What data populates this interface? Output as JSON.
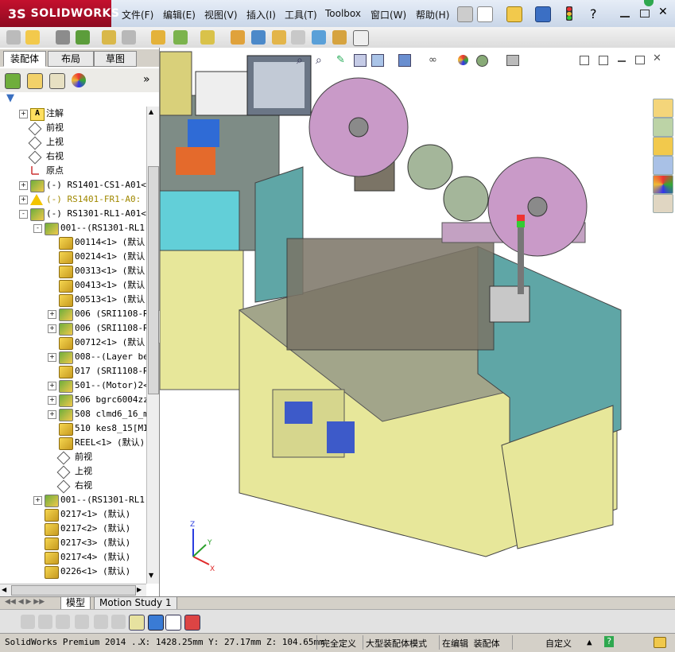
{
  "app": {
    "logo_ds": "3S",
    "logo_name": "SOLIDWORKS"
  },
  "menu": [
    "文件(F)",
    "编辑(E)",
    "视图(V)",
    "插入(I)",
    "工具(T)",
    "Toolbox",
    "窗口(W)",
    "帮助(H)"
  ],
  "panel_tabs": [
    "装配体",
    "布局",
    "草图"
  ],
  "tree": [
    {
      "label": "注解",
      "indent": 0,
      "icon": "note",
      "expand": "+"
    },
    {
      "label": "前视",
      "indent": 0,
      "icon": "plane",
      "expand": ""
    },
    {
      "label": "上视",
      "indent": 0,
      "icon": "plane",
      "expand": ""
    },
    {
      "label": "右视",
      "indent": 0,
      "icon": "plane",
      "expand": ""
    },
    {
      "label": "原点",
      "indent": 0,
      "icon": "origin",
      "expand": ""
    },
    {
      "label": "(-) RS1401-CS1-A01<1",
      "indent": 0,
      "icon": "asm",
      "expand": "+"
    },
    {
      "label": "(-) RS1401-FR1-A0:",
      "indent": 0,
      "icon": "warn",
      "expand": "+",
      "warn": true
    },
    {
      "label": "(-) RS1301-RL1-A01<1",
      "indent": 0,
      "icon": "asm",
      "expand": "-"
    },
    {
      "label": "001--(RS1301-RL1-",
      "indent": 1,
      "icon": "asm",
      "expand": "-"
    },
    {
      "label": "00114<1> (默认",
      "indent": 2,
      "icon": "part",
      "expand": ""
    },
    {
      "label": "00214<1> (默认",
      "indent": 2,
      "icon": "part",
      "expand": ""
    },
    {
      "label": "00313<1> (默认",
      "indent": 2,
      "icon": "part",
      "expand": ""
    },
    {
      "label": "00413<1> (默认",
      "indent": 2,
      "icon": "part",
      "expand": ""
    },
    {
      "label": "00513<1> (默认",
      "indent": 2,
      "icon": "part",
      "expand": ""
    },
    {
      "label": "006 (SRI1108-R",
      "indent": 2,
      "icon": "asm",
      "expand": "+"
    },
    {
      "label": "006 (SRI1108-R",
      "indent": 2,
      "icon": "asm",
      "expand": "+"
    },
    {
      "label": "00712<1> (默认",
      "indent": 2,
      "icon": "part",
      "expand": ""
    },
    {
      "label": "008--(Layer be",
      "indent": 2,
      "icon": "asm",
      "expand": "+"
    },
    {
      "label": "017 (SRI1108-R",
      "indent": 2,
      "icon": "part",
      "expand": ""
    },
    {
      "label": "501--(Motor)2<",
      "indent": 2,
      "icon": "asm",
      "expand": "+"
    },
    {
      "label": "506 bgrc6004zz",
      "indent": 2,
      "icon": "asm",
      "expand": "+"
    },
    {
      "label": "508 clmd6_16_m",
      "indent": 2,
      "icon": "asm",
      "expand": "+"
    },
    {
      "label": "510 kes8_15[MI",
      "indent": 2,
      "icon": "part",
      "expand": ""
    },
    {
      "label": "REEL<1> (默认)",
      "indent": 2,
      "icon": "part",
      "expand": ""
    },
    {
      "label": "前视",
      "indent": 2,
      "icon": "plane",
      "expand": ""
    },
    {
      "label": "上视",
      "indent": 2,
      "icon": "plane",
      "expand": ""
    },
    {
      "label": "右视",
      "indent": 2,
      "icon": "plane",
      "expand": ""
    },
    {
      "label": "001--(RS1301-RL1-",
      "indent": 1,
      "icon": "asm",
      "expand": "+"
    },
    {
      "label": "0217<1> (默认)",
      "indent": 1,
      "icon": "part",
      "expand": ""
    },
    {
      "label": "0217<2> (默认)",
      "indent": 1,
      "icon": "part",
      "expand": ""
    },
    {
      "label": "0217<3> (默认)",
      "indent": 1,
      "icon": "part",
      "expand": ""
    },
    {
      "label": "0217<4> (默认)",
      "indent": 1,
      "icon": "part",
      "expand": ""
    },
    {
      "label": "0226<1> (默认)",
      "indent": 1,
      "icon": "part",
      "expand": ""
    }
  ],
  "bottom_tabs": [
    "模型",
    "Motion Study 1"
  ],
  "status": {
    "product": "SolidWorks Premium 2014 ...",
    "coords": "X: 1428.25mm Y: 27.17mm Z: 104.65mm",
    "defined": "完全定义",
    "mode": "大型装配体模式",
    "editing": "在编辑 装配体",
    "units": "自定义"
  },
  "colors": {
    "logo_red": "#c4102e",
    "machine_yellow": "#e7e79a",
    "panel_teal": "#5fa6a6",
    "reel_purple": "#c99ac8"
  }
}
